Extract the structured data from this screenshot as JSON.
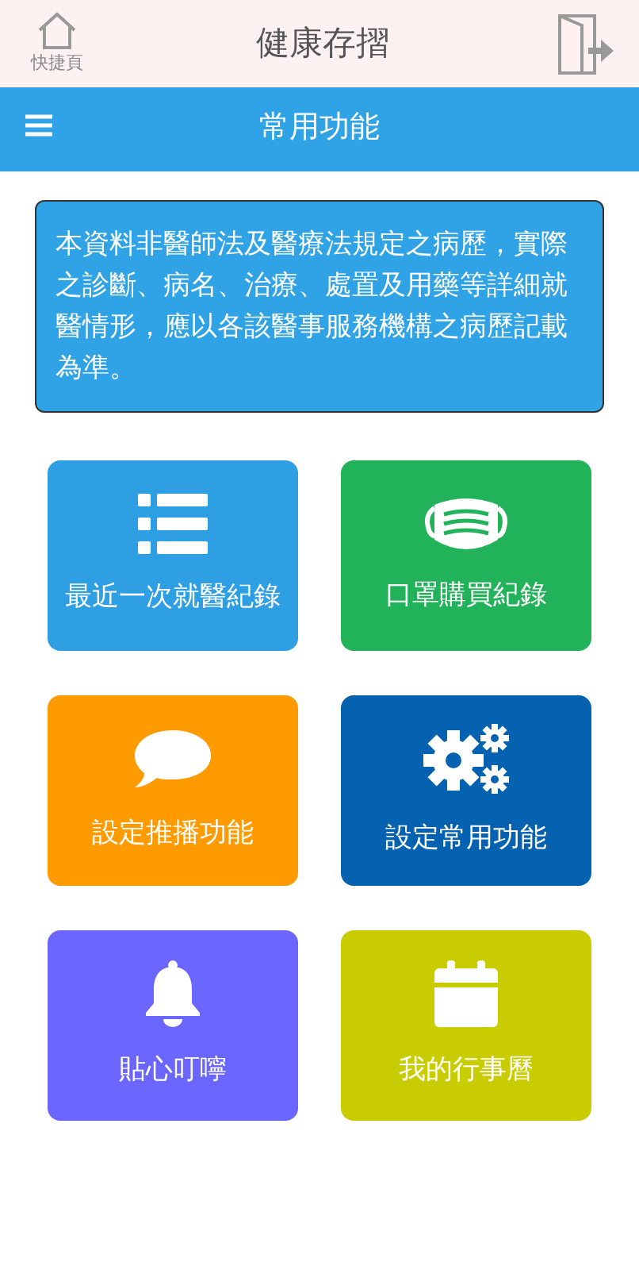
{
  "header": {
    "home_label": "快捷頁",
    "title": "健康存摺"
  },
  "nav_bar": {
    "title": "常用功能"
  },
  "notice": "本資料非醫師法及醫療法規定之病歷，實際之診斷、病名、治療、處置及用藥等詳細就醫情形，應以各該醫事服務機構之病歷記載為準。",
  "tiles": [
    {
      "label": "最近一次就醫紀錄",
      "color": "#2e9fe3"
    },
    {
      "label": "口罩購買紀錄",
      "color": "#22b35a"
    },
    {
      "label": "設定推播功能",
      "color": "#ff9a00"
    },
    {
      "label": "設定常用功能",
      "color": "#0562b0"
    },
    {
      "label": "貼心叮嚀",
      "color": "#6b66ff"
    },
    {
      "label": "我的行事曆",
      "color": "#c9cc00"
    }
  ]
}
